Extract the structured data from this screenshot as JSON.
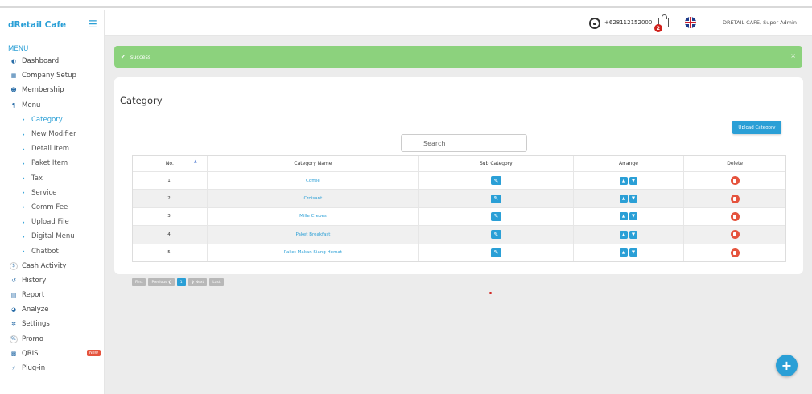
{
  "app": {
    "brand": "dRetail Cafe"
  },
  "sidebar": {
    "menu_title": "MENU",
    "items": [
      {
        "label": "Dashboard",
        "icon": "dashboard-icon",
        "glyph": "◐",
        "sub": false
      },
      {
        "label": "Company Setup",
        "icon": "building-icon",
        "glyph": "▦",
        "sub": false
      },
      {
        "label": "Membership",
        "icon": "users-icon",
        "glyph": "☻",
        "sub": false
      },
      {
        "label": "Menu",
        "icon": "utensils-icon",
        "glyph": "¶",
        "sub": false
      },
      {
        "label": "Category",
        "icon": "chevron-right-icon",
        "glyph": "›",
        "sub": true,
        "active": true
      },
      {
        "label": "New Modifier",
        "icon": "chevron-right-icon",
        "glyph": "›",
        "sub": true
      },
      {
        "label": "Detail Item",
        "icon": "chevron-right-icon",
        "glyph": "›",
        "sub": true
      },
      {
        "label": "Paket Item",
        "icon": "chevron-right-icon",
        "glyph": "›",
        "sub": true
      },
      {
        "label": "Tax",
        "icon": "chevron-right-icon",
        "glyph": "›",
        "sub": true
      },
      {
        "label": "Service",
        "icon": "chevron-right-icon",
        "glyph": "›",
        "sub": true
      },
      {
        "label": "Comm Fee",
        "icon": "chevron-right-icon",
        "glyph": "›",
        "sub": true
      },
      {
        "label": "Upload File",
        "icon": "chevron-right-icon",
        "glyph": "›",
        "sub": true
      },
      {
        "label": "Digital Menu",
        "icon": "chevron-right-icon",
        "glyph": "›",
        "sub": true
      },
      {
        "label": "Chatbot",
        "icon": "chevron-right-icon",
        "glyph": "›",
        "sub": true
      },
      {
        "label": "Cash Activity",
        "icon": "dollar-icon",
        "glyph": "$",
        "sub": false,
        "circle": true
      },
      {
        "label": "History",
        "icon": "history-icon",
        "glyph": "↺",
        "sub": false
      },
      {
        "label": "Report",
        "icon": "report-icon",
        "glyph": "▤",
        "sub": false
      },
      {
        "label": "Analyze",
        "icon": "pie-chart-icon",
        "glyph": "◕",
        "sub": false
      },
      {
        "label": "Settings",
        "icon": "gear-icon",
        "glyph": "✲",
        "sub": false
      },
      {
        "label": "Promo",
        "icon": "percent-icon",
        "glyph": "%",
        "sub": false,
        "circle": true
      },
      {
        "label": "QRIS",
        "icon": "qr-icon",
        "glyph": "▩",
        "sub": false,
        "badge": "New"
      },
      {
        "label": "Plug-in",
        "icon": "plugin-icon",
        "glyph": "⚡",
        "sub": false
      }
    ]
  },
  "header": {
    "phone": "+628112152000",
    "cart_count": "2",
    "user": "DRETAIL CAFE, Super Admin"
  },
  "alert": {
    "message": "success",
    "close": "×"
  },
  "page": {
    "title": "Category",
    "upload_button": "Upload Category",
    "search_placeholder": "Search"
  },
  "table": {
    "headers": [
      "No.",
      "Category Name",
      "Sub Category",
      "Arrange",
      "Delete"
    ],
    "rows": [
      {
        "no": "1.",
        "name": "Coffee"
      },
      {
        "no": "2.",
        "name": "Croisant"
      },
      {
        "no": "3.",
        "name": "Mille Crepes"
      },
      {
        "no": "4.",
        "name": "Paket Breakfast"
      },
      {
        "no": "5.",
        "name": "Paket Makan Siang Hemat"
      }
    ]
  },
  "pagination": {
    "first": "First",
    "previous": "Previous ❮",
    "current": "1",
    "next": "❯ Next",
    "last": "Last"
  },
  "colors": {
    "accent": "#2a9fd6",
    "success": "#8cd27d",
    "danger": "#e5533d"
  }
}
